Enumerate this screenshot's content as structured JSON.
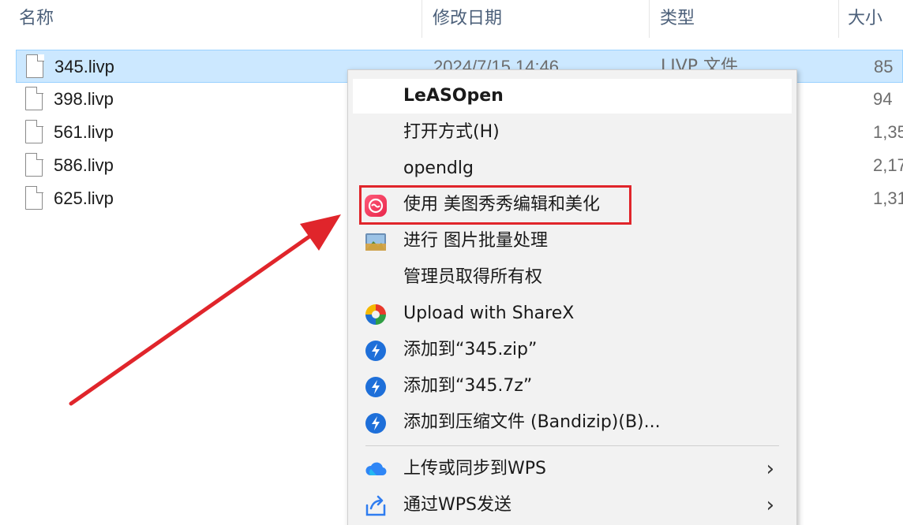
{
  "columns": {
    "name": "名称",
    "date": "修改日期",
    "type": "类型",
    "size": "大小"
  },
  "files": [
    {
      "name": "345.livp",
      "date": "2024/7/15 14:46",
      "type": "LIVP 文件",
      "size": "85",
      "selected": true
    },
    {
      "name": "398.livp",
      "date": "",
      "type": "",
      "size": "94"
    },
    {
      "name": "561.livp",
      "date": "",
      "type": "",
      "size": "1,35"
    },
    {
      "name": "586.livp",
      "date": "",
      "type": "",
      "size": "2,17"
    },
    {
      "name": "625.livp",
      "date": "",
      "type": "",
      "size": "1,31"
    }
  ],
  "menu": {
    "items": [
      {
        "label": "LeASOpen",
        "bold": true,
        "icon": ""
      },
      {
        "label": "打开方式(H)",
        "icon": ""
      },
      {
        "label": "opendlg",
        "icon": ""
      },
      {
        "label": "使用 美图秀秀编辑和美化",
        "icon": "meitu-icon"
      },
      {
        "label": "进行 图片批量处理",
        "icon": "batch-image-icon"
      },
      {
        "label": "管理员取得所有权",
        "icon": ""
      },
      {
        "label": "Upload with ShareX",
        "icon": "sharex-icon"
      },
      {
        "label": "添加到“345.zip”",
        "icon": "bandizip-icon"
      },
      {
        "label": "添加到“345.7z”",
        "icon": "bandizip-icon"
      },
      {
        "label": "添加到压缩文件 (Bandizip)(B)...",
        "icon": "bandizip-icon"
      },
      {
        "label": "上传或同步到WPS",
        "icon": "wps-cloud-icon",
        "submenu": true
      },
      {
        "label": "通过WPS发送",
        "icon": "wps-share-icon",
        "submenu": true
      }
    ]
  },
  "colors": {
    "highlight": "#e0252b",
    "arrow": "#e0252b",
    "selection": "#cce8ff"
  }
}
